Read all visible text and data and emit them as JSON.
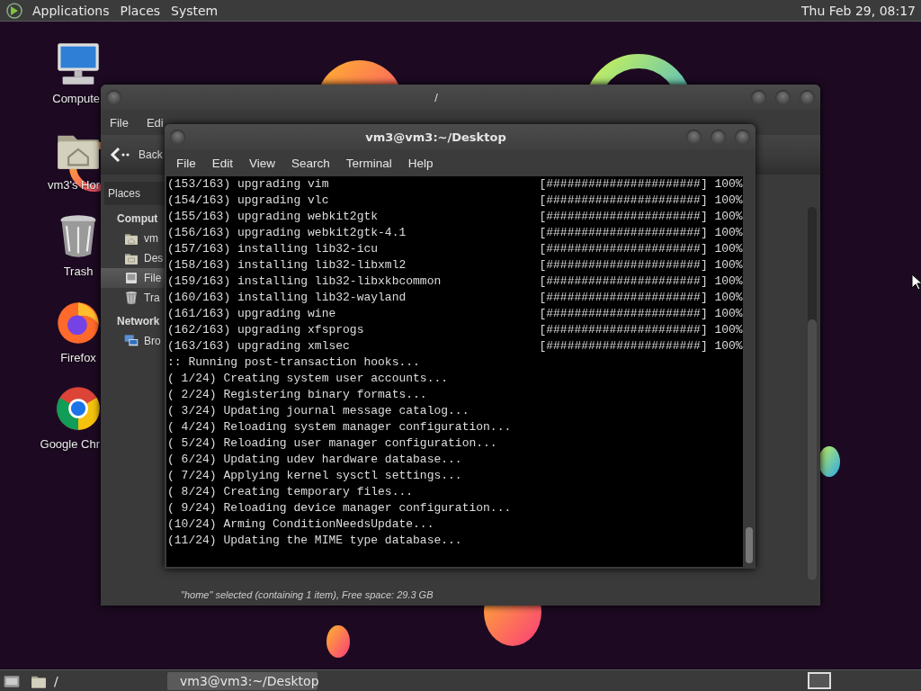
{
  "top_panel": {
    "menus": [
      "Applications",
      "Places",
      "System"
    ],
    "clock": "Thu Feb 29, 08:17"
  },
  "desktop_icons": [
    {
      "label": "Compute",
      "kind": "computer"
    },
    {
      "label": "vm3's Hor",
      "kind": "home"
    },
    {
      "label": "Trash",
      "kind": "trash"
    },
    {
      "label": "Firefox",
      "kind": "firefox"
    },
    {
      "label": "Google Chr",
      "kind": "chrome"
    }
  ],
  "file_manager": {
    "title": "/",
    "menus": [
      "File",
      "Edi"
    ],
    "back": "Back",
    "sidebar": {
      "header": "Places",
      "sections": [
        {
          "title": "Comput",
          "items": [
            {
              "label": "vm",
              "kind": "home",
              "selected": false
            },
            {
              "label": "Des",
              "kind": "desktop",
              "selected": false
            },
            {
              "label": "File",
              "kind": "filesystem",
              "selected": true
            },
            {
              "label": "Tra",
              "kind": "trash",
              "selected": false
            }
          ]
        },
        {
          "title": "Network",
          "items": [
            {
              "label": "Bro",
              "kind": "network",
              "selected": false
            }
          ]
        }
      ]
    },
    "status": "\"home\" selected (containing 1 item), Free space: 29.3 GB"
  },
  "terminal": {
    "title": "vm3@vm3:~/Desktop",
    "menus": [
      "File",
      "Edit",
      "View",
      "Search",
      "Terminal",
      "Help"
    ],
    "lines": [
      {
        "text": "(153/163) upgrading vim",
        "bar": "[######################]",
        "percent": "100%"
      },
      {
        "text": "(154/163) upgrading vlc",
        "bar": "[######################]",
        "percent": "100%"
      },
      {
        "text": "(155/163) upgrading webkit2gtk",
        "bar": "[######################]",
        "percent": "100%"
      },
      {
        "text": "(156/163) upgrading webkit2gtk-4.1",
        "bar": "[######################]",
        "percent": "100%"
      },
      {
        "text": "(157/163) installing lib32-icu",
        "bar": "[######################]",
        "percent": "100%"
      },
      {
        "text": "(158/163) installing lib32-libxml2",
        "bar": "[######################]",
        "percent": "100%"
      },
      {
        "text": "(159/163) installing lib32-libxkbcommon",
        "bar": "[######################]",
        "percent": "100%"
      },
      {
        "text": "(160/163) installing lib32-wayland",
        "bar": "[######################]",
        "percent": "100%"
      },
      {
        "text": "(161/163) upgrading wine",
        "bar": "[######################]",
        "percent": "100%"
      },
      {
        "text": "(162/163) upgrading xfsprogs",
        "bar": "[######################]",
        "percent": "100%"
      },
      {
        "text": "(163/163) upgrading xmlsec",
        "bar": "[######################]",
        "percent": "100%"
      },
      {
        "text": ":: Running post-transaction hooks..."
      },
      {
        "text": "( 1/24) Creating system user accounts..."
      },
      {
        "text": "( 2/24) Registering binary formats..."
      },
      {
        "text": "( 3/24) Updating journal message catalog..."
      },
      {
        "text": "( 4/24) Reloading system manager configuration..."
      },
      {
        "text": "( 5/24) Reloading user manager configuration..."
      },
      {
        "text": "( 6/24) Updating udev hardware database..."
      },
      {
        "text": "( 7/24) Applying kernel sysctl settings..."
      },
      {
        "text": "( 8/24) Creating temporary files..."
      },
      {
        "text": "( 9/24) Reloading device manager configuration..."
      },
      {
        "text": "(10/24) Arming ConditionNeedsUpdate..."
      },
      {
        "text": "(11/24) Updating the MIME type database..."
      }
    ]
  },
  "taskbar": {
    "tasks": [
      {
        "label": "/",
        "kind": "folder",
        "selected": false
      },
      {
        "label": "vm3@vm3:~/Desktop",
        "kind": "terminal",
        "selected": true
      }
    ]
  }
}
